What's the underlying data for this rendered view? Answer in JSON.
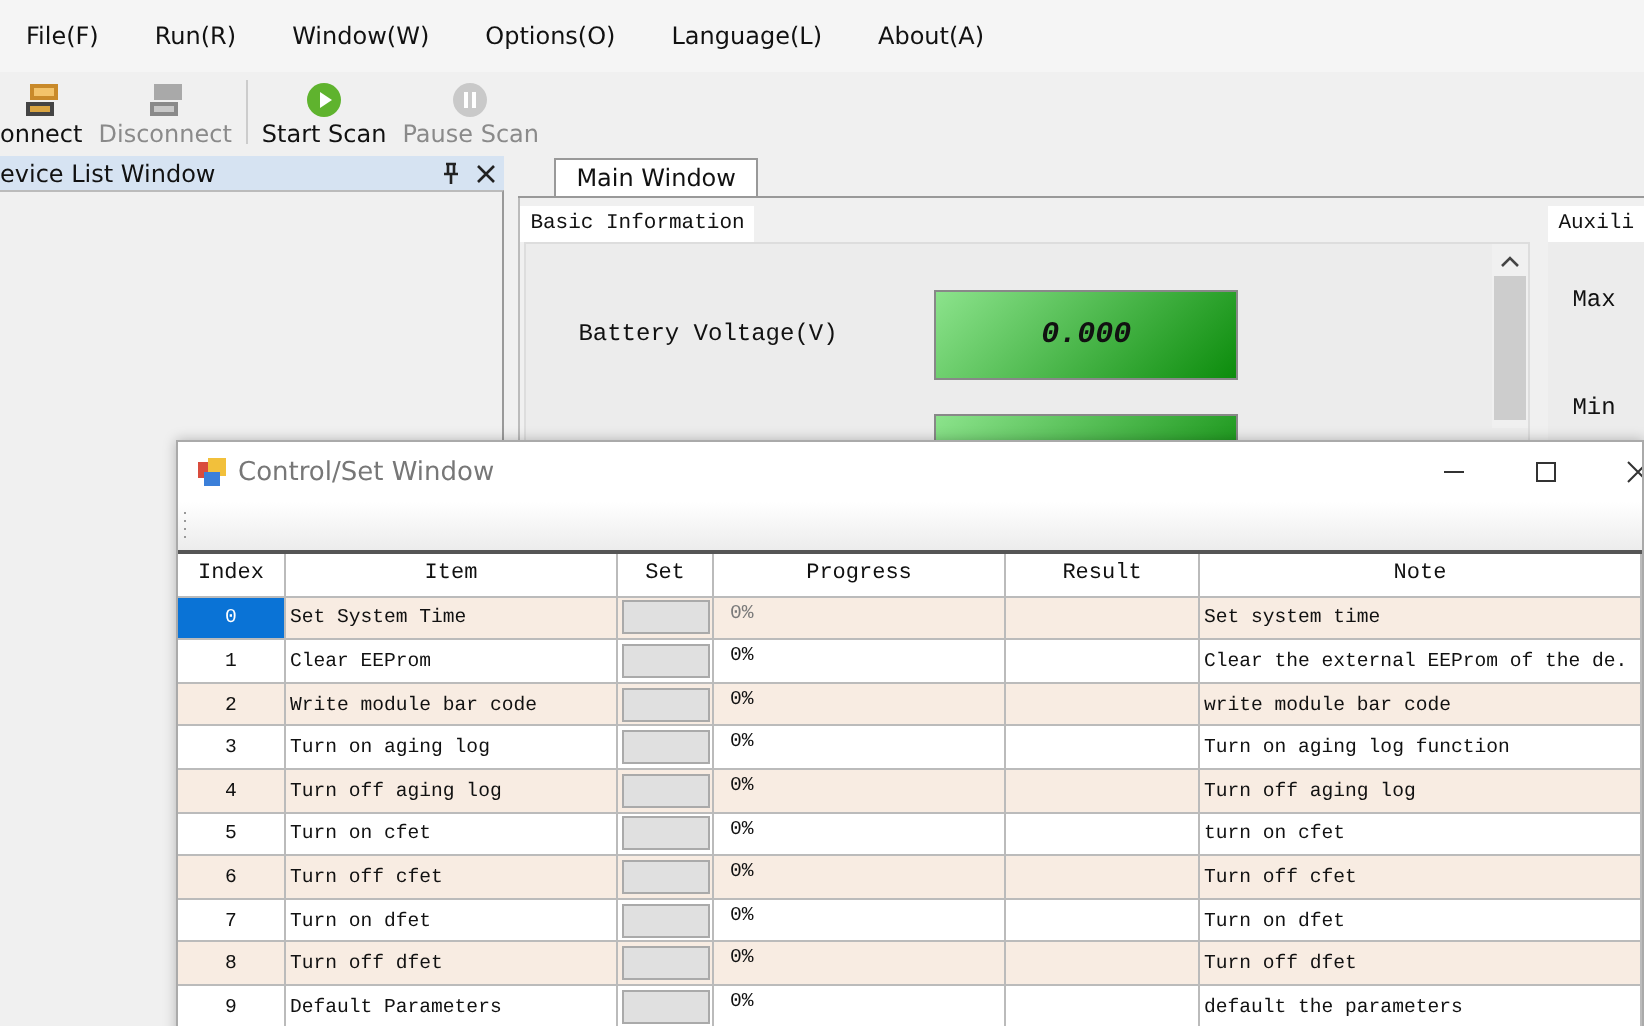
{
  "menu": [
    "File(F)",
    "Run(R)",
    "Window(W)",
    "Options(O)",
    "Language(L)",
    "About(A)"
  ],
  "toolbar": [
    {
      "kind": "connect",
      "label": "onnect",
      "disabled": false
    },
    {
      "kind": "disconnect",
      "label": "Disconnect",
      "disabled": true
    },
    {
      "kind": "play",
      "label": "Start Scan",
      "disabled": false
    },
    {
      "kind": "pause",
      "label": "Pause Scan",
      "disabled": true
    }
  ],
  "device_panel": {
    "title": "evice List Window"
  },
  "main_tabs": [
    {
      "label": "Main Window",
      "selected": true
    }
  ],
  "basic_info": {
    "title": "Basic Information",
    "fields": [
      {
        "label": "Battery Voltage(V)",
        "value": "0.000"
      }
    ]
  },
  "aux_panel": {
    "title": "Auxili",
    "labels": [
      "Max",
      "Min"
    ]
  },
  "control_window": {
    "title": "Control/Set Window",
    "columns": [
      "Index",
      "Item",
      "Set",
      "Progress",
      "Result",
      "Note"
    ],
    "rows": [
      {
        "index": "0",
        "item": "Set System Time",
        "progress": "0%",
        "note": "Set system time",
        "selected": true
      },
      {
        "index": "1",
        "item": "Clear EEProm",
        "progress": "0%",
        "note": "Clear the external EEProm of the de.",
        "selected": false
      },
      {
        "index": "2",
        "item": "Write module bar code",
        "progress": "0%",
        "note": "write module bar code",
        "selected": false
      },
      {
        "index": "3",
        "item": "Turn on aging log",
        "progress": "0%",
        "note": "Turn on aging log function",
        "selected": false
      },
      {
        "index": "4",
        "item": "Turn off aging log",
        "progress": "0%",
        "note": "Turn off aging log",
        "selected": false
      },
      {
        "index": "5",
        "item": "Turn on cfet",
        "progress": "0%",
        "note": "turn on cfet",
        "selected": false
      },
      {
        "index": "6",
        "item": "Turn off cfet",
        "progress": "0%",
        "note": "Turn off cfet",
        "selected": false
      },
      {
        "index": "7",
        "item": "Turn on dfet",
        "progress": "0%",
        "note": "Turn on dfet",
        "selected": false
      },
      {
        "index": "8",
        "item": "Turn off dfet",
        "progress": "0%",
        "note": "Turn off dfet",
        "selected": false
      },
      {
        "index": "9",
        "item": "Default Parameters",
        "progress": "0%",
        "note": "default the parameters",
        "selected": false
      }
    ]
  }
}
